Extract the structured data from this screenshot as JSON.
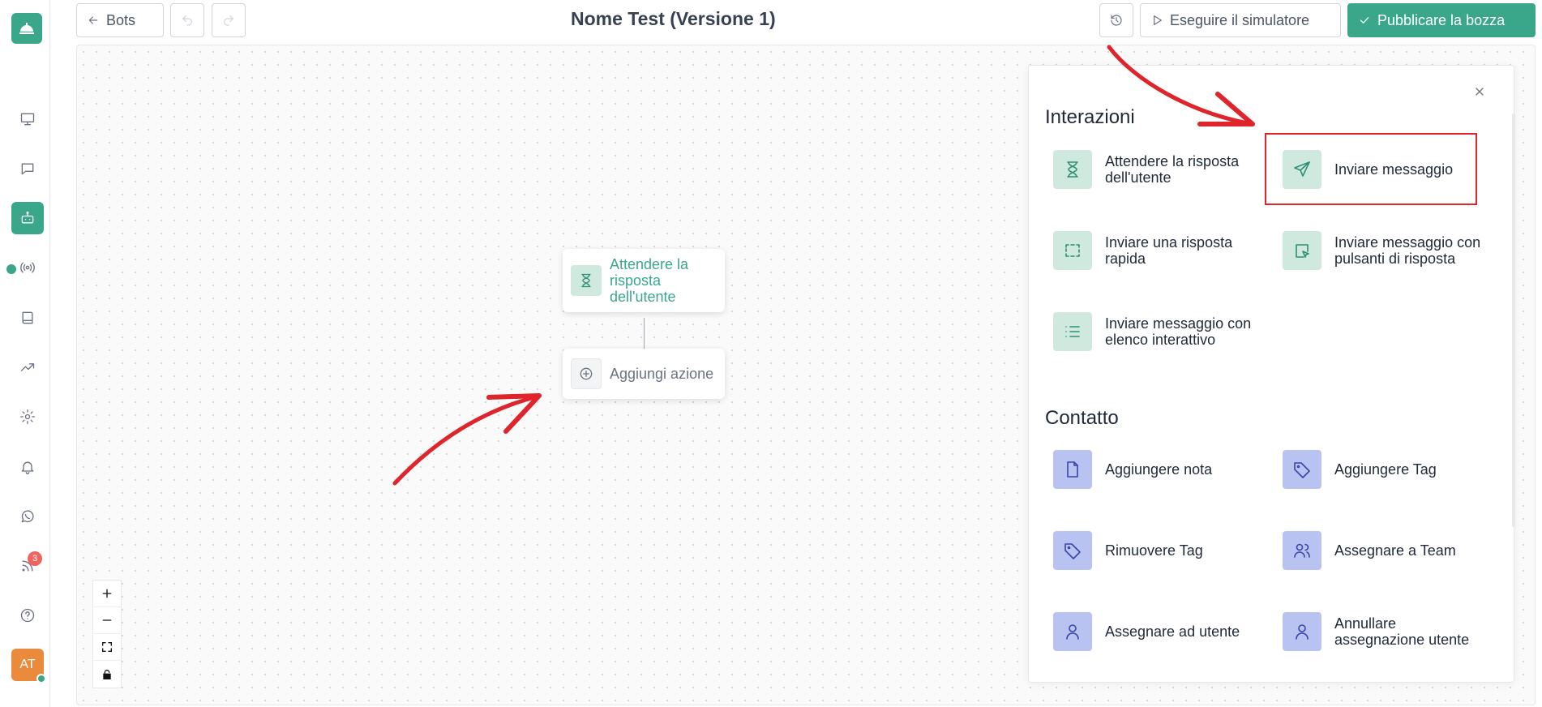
{
  "header": {
    "back_label": "Bots",
    "title": "Nome Test (Versione 1)",
    "simulator_label": "Eseguire il simulatore",
    "publish_label": "Pubblicare la bozza"
  },
  "sidebar": {
    "avatar_initials": "AT",
    "notification_count": "3"
  },
  "canvas": {
    "node_wait_label": "Attendere la risposta dell'utente",
    "node_add_label": "Aggiungi azione"
  },
  "panel": {
    "section_interactions": "Interazioni",
    "section_contact": "Contatto",
    "interactions": [
      {
        "label": "Attendere la risposta dell'utente",
        "icon": "hourglass-icon"
      },
      {
        "label": "Inviare messaggio",
        "icon": "send-icon"
      },
      {
        "label": "Inviare una risposta rapida",
        "icon": "quick-reply-icon"
      },
      {
        "label": "Inviare messaggio con pulsanti di risposta",
        "icon": "cursor-click-icon"
      },
      {
        "label": "Inviare messaggio con elenco interattivo",
        "icon": "list-icon"
      }
    ],
    "contact": [
      {
        "label": "Aggiungere nota",
        "icon": "note-icon"
      },
      {
        "label": "Aggiungere Tag",
        "icon": "tag-icon"
      },
      {
        "label": "Rimuovere Tag",
        "icon": "tag-icon"
      },
      {
        "label": "Assegnare a Team",
        "icon": "users-icon"
      },
      {
        "label": "Assegnare ad utente",
        "icon": "user-icon"
      },
      {
        "label": "Annullare assegnazione utente",
        "icon": "user-icon"
      }
    ]
  },
  "colors": {
    "accent": "#3aa78a",
    "contact_icon_bg": "#b9c3f2",
    "annotation_red": "#e0242b"
  }
}
